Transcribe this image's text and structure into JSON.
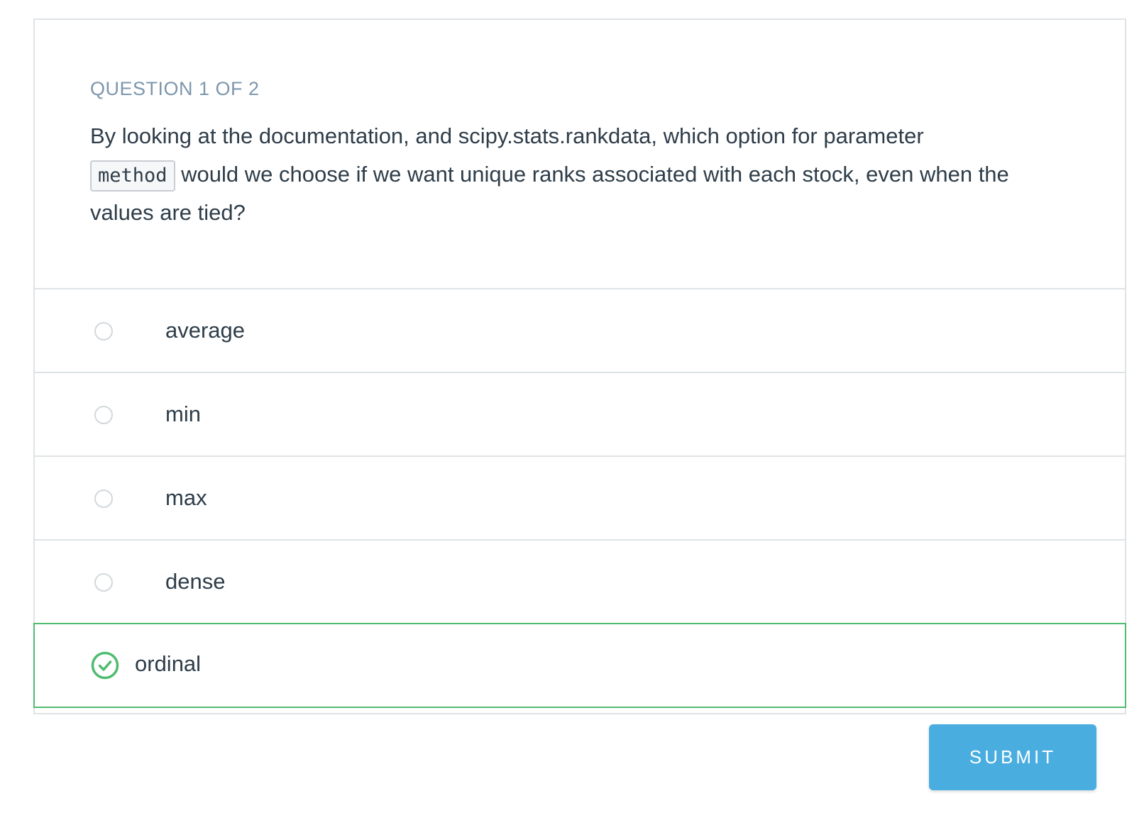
{
  "quiz": {
    "counter": "QUESTION 1 OF 2",
    "question_before_code": "By looking at the documentation, and scipy.stats.rankdata, which option for parameter",
    "code_term": "method",
    "question_after_code": "would we choose if we want unique ranks associated with each stock, even when the values are tied?",
    "options": [
      {
        "label": "average",
        "selected": false
      },
      {
        "label": "min",
        "selected": false
      },
      {
        "label": "max",
        "selected": false
      },
      {
        "label": "dense",
        "selected": false
      },
      {
        "label": "ordinal",
        "selected": true
      }
    ],
    "submit_label": "SUBMIT"
  },
  "colors": {
    "accent_green": "#4fbc6f",
    "submit_blue": "#4aade0",
    "counter_gray": "#7d97ad",
    "text_dark": "#2e3d49",
    "border": "#dfe3e6"
  }
}
